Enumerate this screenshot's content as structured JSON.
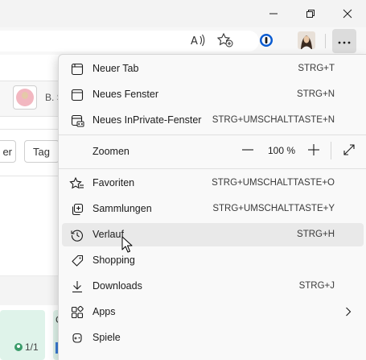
{
  "window": {
    "minimize": "minimize",
    "restore": "restore",
    "close": "close"
  },
  "toolbar": {
    "icons": [
      "read-aloud-icon",
      "add-favorite-icon",
      "password-manager-icon",
      "profile-avatar",
      "settings-more-icon"
    ]
  },
  "page": {
    "user_initial": "B. S",
    "filter_button_partial": "er",
    "day_button": "Tag",
    "card_count": "1/1",
    "card_letter_partial": "C"
  },
  "menu": {
    "items": [
      {
        "label": "Neuer Tab",
        "shortcut": "STRG+T",
        "icon": "new-tab-icon"
      },
      {
        "label": "Neues Fenster",
        "shortcut": "STRG+N",
        "icon": "new-window-icon"
      },
      {
        "label": "Neues InPrivate-Fenster",
        "shortcut": "STRG+UMSCHALTTASTE+N",
        "icon": "inprivate-window-icon"
      },
      {
        "label": "Zoomen",
        "shortcut": "",
        "icon": ""
      },
      {
        "label": "Favoriten",
        "shortcut": "STRG+UMSCHALTTASTE+O",
        "icon": "favorites-icon"
      },
      {
        "label": "Sammlungen",
        "shortcut": "STRG+UMSCHALTTASTE+Y",
        "icon": "collections-icon"
      },
      {
        "label": "Verlauf",
        "shortcut": "STRG+H",
        "icon": "history-icon"
      },
      {
        "label": "Shopping",
        "shortcut": "",
        "icon": "shopping-tag-icon"
      },
      {
        "label": "Downloads",
        "shortcut": "STRG+J",
        "icon": "download-icon"
      },
      {
        "label": "Apps",
        "shortcut": "",
        "icon": "apps-icon"
      },
      {
        "label": "Spiele",
        "shortcut": "",
        "icon": "games-icon"
      }
    ],
    "zoom_value": "100 %",
    "hovered_item": "Verlauf"
  },
  "colors": {
    "menu_bg": "#f9f9f9",
    "hover_bg": "#e9e9e9",
    "password_manager": "#0a5bd1",
    "card_green": "#dff3ea"
  }
}
